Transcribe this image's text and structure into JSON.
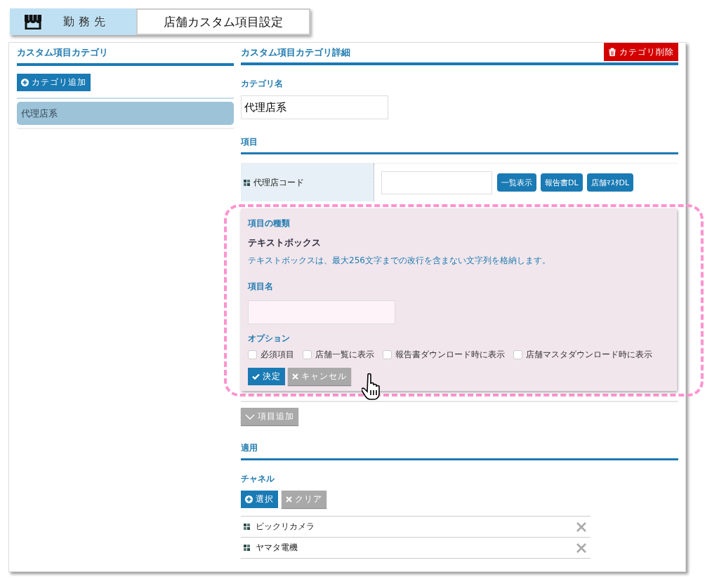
{
  "header": {
    "section_label": "勤務先",
    "page_title": "店舗カスタム項目設定"
  },
  "sidebar": {
    "title": "カスタム項目カテゴリ",
    "add_button": "カテゴリ追加",
    "items": [
      {
        "label": "代理店系",
        "selected": true
      }
    ]
  },
  "detail": {
    "title": "カスタム項目カテゴリ詳細",
    "delete_button": "カテゴリ削除",
    "category_name_label": "カテゴリ名",
    "category_name_value": "代理店系",
    "items_heading": "項目",
    "items": [
      {
        "label": "代理店コード",
        "buttons": [
          "一覧表示",
          "報告書DL",
          "店舗ﾏｽﾀDL"
        ]
      }
    ],
    "editor": {
      "type_label": "項目の種類",
      "type_name": "テキストボックス",
      "type_description": "テキストボックスは、最大256文字までの改行を含まない文字列を格納します。",
      "name_label": "項目名",
      "options_label": "オプション",
      "options": [
        {
          "label": "必須項目",
          "checked": false
        },
        {
          "label": "店舗一覧に表示",
          "checked": false
        },
        {
          "label": "報告書ダウンロード時に表示",
          "checked": false
        },
        {
          "label": "店舗マスタダウンロード時に表示",
          "checked": false
        }
      ],
      "ok_button": "決定",
      "cancel_button": "キャンセル"
    },
    "add_item_button": "項目追加",
    "apply_heading": "適用",
    "channel_label": "チャネル",
    "select_button": "選択",
    "clear_button": "クリア",
    "channels": [
      {
        "name": "ビックリカメラ"
      },
      {
        "name": "ヤマタ電機"
      }
    ]
  }
}
